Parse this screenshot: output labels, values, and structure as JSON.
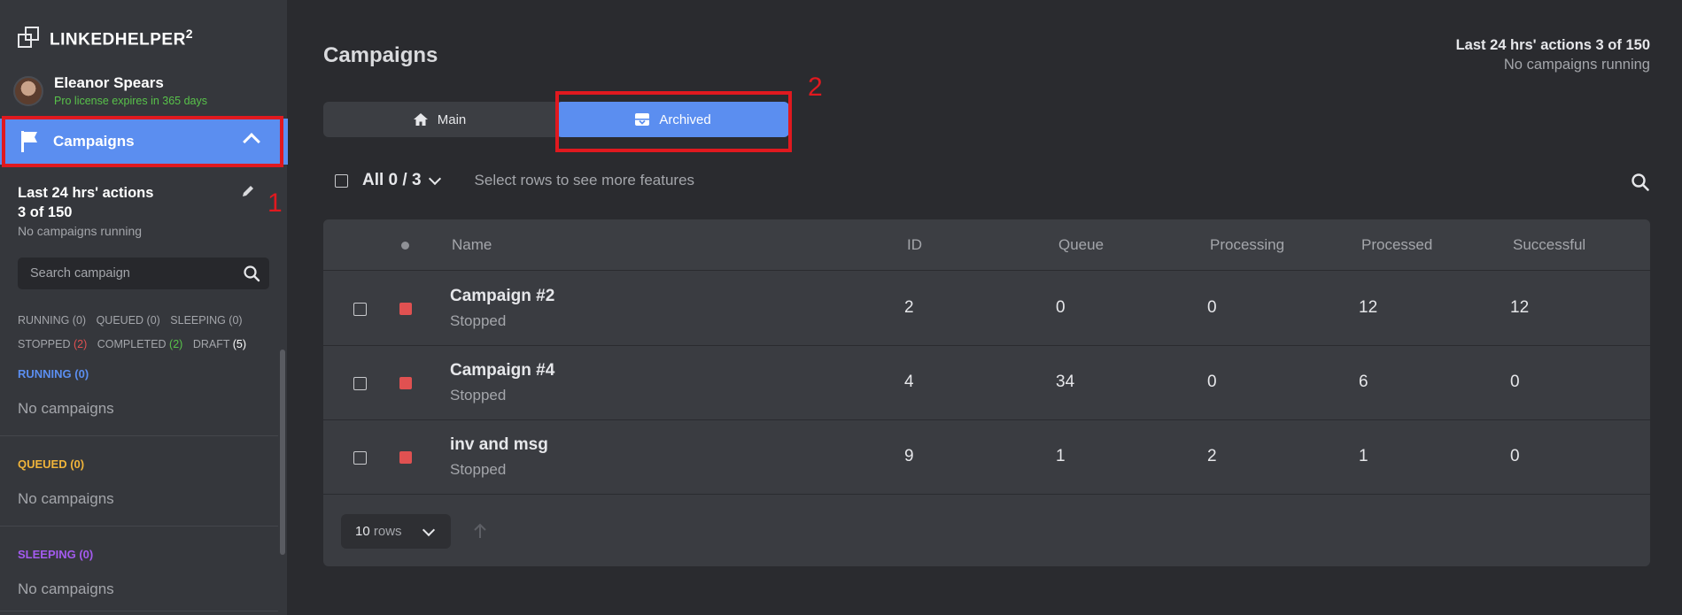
{
  "brand": {
    "name": "LINKEDHELPER",
    "sup": "2"
  },
  "user": {
    "name": "Eleanor Spears",
    "license": "Pro license expires in 365 days"
  },
  "sidebar": {
    "nav_label": "Campaigns",
    "stats_line1": "Last 24 hrs' actions",
    "stats_line2": "3 of 150",
    "stats_sub": "No campaigns running",
    "search_placeholder": "Search campaign",
    "filters": {
      "running": "RUNNING (0)",
      "queued": "QUEUED (0)",
      "sleeping": "SLEEPING (0)",
      "stopped_label": "STOPPED",
      "stopped_count": "(2)",
      "completed_label": "COMPLETED",
      "completed_count": "(2)",
      "draft_label": "DRAFT",
      "draft_count": "(5)"
    },
    "groups": [
      {
        "head": "RUNNING (0)",
        "empty": "No campaigns",
        "color": "#5b8ef0"
      },
      {
        "head": "QUEUED (0)",
        "empty": "No campaigns",
        "color": "#f0b43a"
      },
      {
        "head": "SLEEPING (0)",
        "empty": "No campaigns",
        "color": "#a45bf0"
      }
    ]
  },
  "callouts": {
    "one": "1",
    "two": "2"
  },
  "main": {
    "title": "Campaigns",
    "top_right_line1": "Last 24 hrs' actions 3 of 150",
    "top_right_line2": "No campaigns running",
    "tabs": {
      "main": "Main",
      "archived": "Archived"
    },
    "select_label": "All 0 / 3",
    "hint": "Select rows to see more features",
    "columns": {
      "name": "Name",
      "id": "ID",
      "queue": "Queue",
      "processing": "Processing",
      "processed": "Processed",
      "successful": "Successful"
    },
    "rows": [
      {
        "name": "Campaign #2",
        "state": "Stopped",
        "id": "2",
        "queue": "0",
        "processing": "0",
        "processed": "12",
        "successful": "12"
      },
      {
        "name": "Campaign #4",
        "state": "Stopped",
        "id": "4",
        "queue": "34",
        "processing": "0",
        "processed": "6",
        "successful": "0"
      },
      {
        "name": "inv and msg",
        "state": "Stopped",
        "id": "9",
        "queue": "1",
        "processing": "2",
        "processed": "1",
        "successful": "0"
      }
    ],
    "rows_per_page_num": "10",
    "rows_per_page_unit": "rows"
  },
  "colors": {
    "accent": "#5b8ef0",
    "stopped": "#e05151",
    "license": "#58c24a",
    "highlight": "#e0191f"
  }
}
